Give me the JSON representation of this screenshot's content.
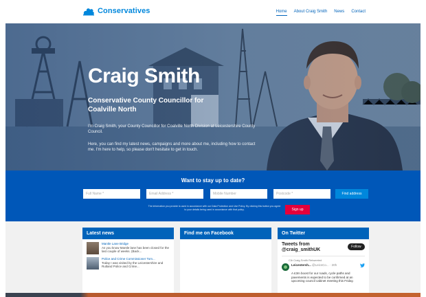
{
  "brand": {
    "name": "Conservatives",
    "logo_icon": "tree-icon",
    "color": "#0087dc"
  },
  "nav": {
    "items": [
      "Home",
      "About Craig Smith",
      "News",
      "Contact"
    ],
    "active": "Home"
  },
  "hero": {
    "name": "Craig Smith",
    "role": "Conservative County Councillor for Coalville North",
    "intro": "I'm Craig Smith, your County Councillor for Coalville North Division at Leicestershire County Council.",
    "body": "Here, you can find my latest news, campaigns and more about me, including how to contact me. I'm here to help, so please don't hesitate to get in touch."
  },
  "subscribe": {
    "title": "Want to stay up to date?",
    "fields": [
      {
        "placeholder": "Full Name *"
      },
      {
        "placeholder": "Email Address *"
      },
      {
        "placeholder": "Mobile Number"
      },
      {
        "placeholder": "Postcode *"
      }
    ],
    "find_label": "Find address",
    "disclaimer": "The information you provide is used in accordance with our Data Protection and Use Policy. By clicking this button you agree to your details being used in accordance with that policy.",
    "signup_label": "Sign up",
    "accent": "#e4003b",
    "band_color": "#0057b8"
  },
  "latest_news": {
    "title": "Latest news",
    "items": [
      {
        "title": "Mantle Lane Bridge",
        "text": "As you know Mantle lane has been closed for the last couple of weeks. (Back..."
      },
      {
        "title": "Police and Crime Commissioner Tom...",
        "text": "Today I was visited by the Leicestershire and Rutland Police and Crime..."
      }
    ]
  },
  "facebook": {
    "title": "Find me on Facebook"
  },
  "twitter": {
    "title": "On Twitter",
    "feed_title": "Tweets from @craig_smithUK",
    "follow_label": "Follow",
    "retweet_by": "Cllr Craig Smith Retweeted",
    "author": "Leicestersh...",
    "handle": "@LeicsCo...",
    "time": "20h",
    "text": "A £3m boost for our roads, cycle paths and pavements is expected to be confirmed at an upcoming council cabinet meeting this Friday."
  }
}
